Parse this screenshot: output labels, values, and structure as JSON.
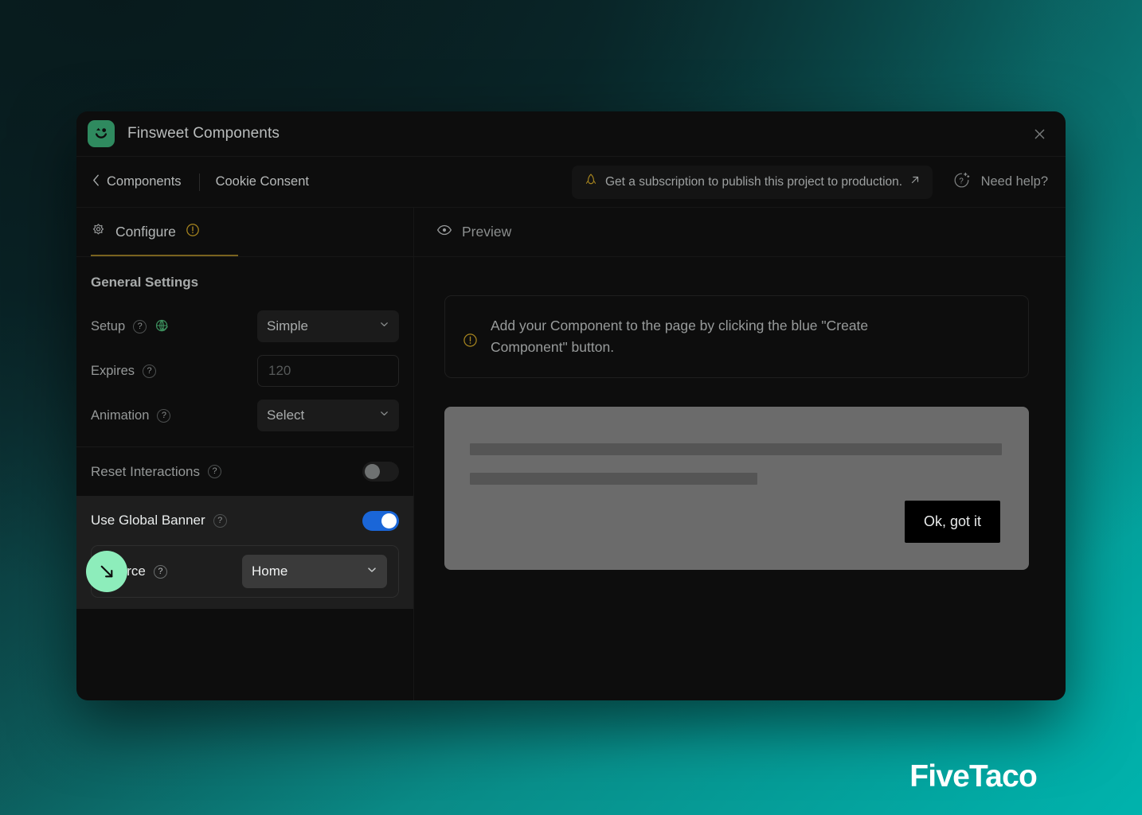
{
  "window": {
    "title": "Finsweet Components",
    "logo_icon": "smiley-face-icon",
    "close_icon": "close-icon"
  },
  "breadcrumb": {
    "back_icon": "chevron-left-icon",
    "back_label": "Components",
    "current_label": "Cookie Consent"
  },
  "subscription_banner": {
    "icon": "rocket-icon",
    "text": "Get a subscription to publish this project to production.",
    "external_icon": "arrow-up-right-icon"
  },
  "need_help": {
    "icon": "question-sparkle-icon",
    "label": "Need help?"
  },
  "tabs": {
    "configure": {
      "icon": "gear-icon",
      "label": "Configure",
      "badge_icon": "warning-circle-icon",
      "active": true
    },
    "preview": {
      "icon": "eye-icon",
      "label": "Preview",
      "active": false
    }
  },
  "settings": {
    "section_title": "General Settings",
    "rows": [
      {
        "label": "Setup",
        "help_icon": "help-circle-icon",
        "status_icon": "globe-check-icon",
        "control": "select",
        "value": "Simple",
        "chevron_icon": "chevron-down-icon"
      },
      {
        "label": "Expires",
        "help_icon": "help-circle-icon",
        "control": "input",
        "placeholder": "120",
        "value": ""
      },
      {
        "label": "Animation",
        "help_icon": "help-circle-icon",
        "control": "select",
        "value": "Select",
        "chevron_icon": "chevron-down-icon"
      }
    ],
    "toggles": [
      {
        "label": "Reset Interactions",
        "help_icon": "help-circle-icon",
        "state": "off"
      },
      {
        "label": "Use Global Banner",
        "help_icon": "help-circle-icon",
        "state": "on"
      }
    ],
    "source_field": {
      "label": "Source",
      "help_icon": "help-circle-icon",
      "value": "Home",
      "chevron_icon": "chevron-down-icon"
    }
  },
  "preview": {
    "notice": {
      "icon": "warning-circle-icon",
      "text": "Add your Component to the page by clicking the blue \"Create Component\" button."
    },
    "banner_mock": {
      "button_label": "Ok, got it"
    }
  },
  "watermark": {
    "text": "FiveTaco"
  },
  "colors": {
    "accent_green": "#2f8a5f",
    "cursor_green": "#8dedbb",
    "toggle_on_blue": "#1a66d8",
    "warning_amber": "#a8861f",
    "background_teal": "#00b3ad"
  }
}
